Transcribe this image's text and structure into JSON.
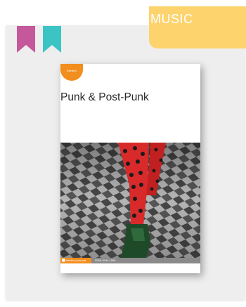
{
  "category": {
    "label": "MUSIC"
  },
  "bookmarks": [
    {
      "name": "pink",
      "color": "#c4589a"
    },
    {
      "name": "teal",
      "color": "#3cc4c4"
    }
  ],
  "cover": {
    "badge": "Intellect",
    "title": "Punk & Post-Punk",
    "publisher": "intellect journals",
    "issn": "ISSN 2044-1983",
    "accent": "#f28e1e"
  },
  "colors": {
    "tag": "#fdd36e",
    "card": "#eeeeee"
  }
}
